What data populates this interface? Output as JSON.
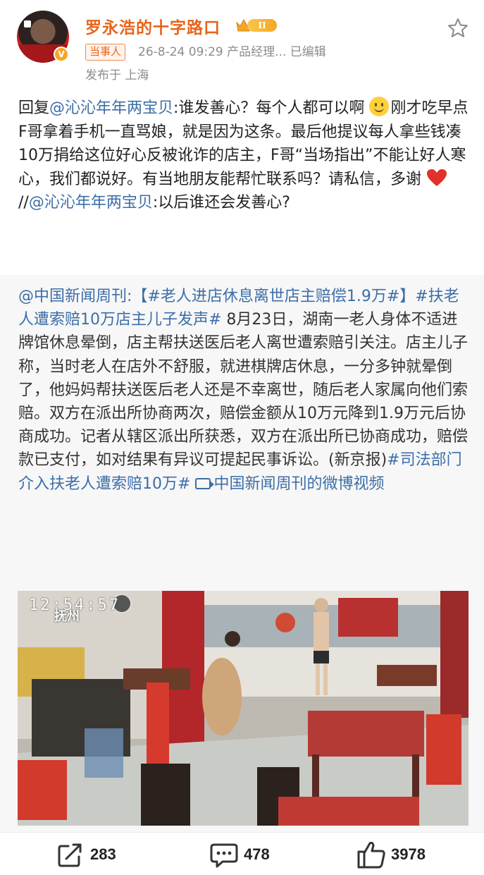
{
  "header": {
    "username": "罗永浩的十字路口",
    "level_badge": "II",
    "tag": "当事人",
    "meta": "26-8-24 09:29  产品经理...  已编辑",
    "location": "发布于 上海",
    "avatar_label": "avatar"
  },
  "reply": {
    "prefix": "回复",
    "mention1": "@沁沁年年两宝贝",
    "line1_rest": ":谁发善心？每个人都可以啊",
    "line2": "刚才吃早点F哥拿着手机一直骂娘，就是因为这条。最后他提议每人拿些钱凑10万捐给这位好心反被讹诈的店主，F哥“当场指出”不能让好人寒心，我们都说好。有当地朋友能帮忙联系吗？请私信，多谢",
    "sep": "//",
    "mention2": "@沁沁年年两宝贝",
    "tail": ":以后谁还会发善心?"
  },
  "repost": {
    "source": "@中国新闻周刊",
    "topic1": ":【#老人进店休息离世店主赔偿1.9万#】",
    "topic2": "#扶老人遭索赔10万店主儿子发声#",
    "body": " 8月23日，湖南一老人身体不适进牌馆休息晕倒，店主帮扶送医后老人离世遭索赔引关注。店主儿子称，当时老人在店外不舒服，就进棋牌店休息，一分多钟就晕倒了，他妈妈帮扶送医后老人还是不幸离世，随后老人家属向他们索赔。双方在派出所协商两次，赔偿金额从10万元降到1.9万元后协商成功。记者从辖区派出所获悉，双方在派出所已协商成功，赔偿款已支付，如对结果有异议可提起民事诉讼。(新京报)",
    "topic3": "#司法部门介入扶老人遭索赔10万#",
    "video_link": "中国新闻周刊的微博视频"
  },
  "video": {
    "timestamp": "12:54:57",
    "watermark": "抚州"
  },
  "actions": {
    "share_count": "283",
    "comment_count": "478",
    "like_count": "3978"
  },
  "colors": {
    "username": "#e8641b",
    "link": "#3c6ea8",
    "repost_bg": "#f7f7f7"
  }
}
